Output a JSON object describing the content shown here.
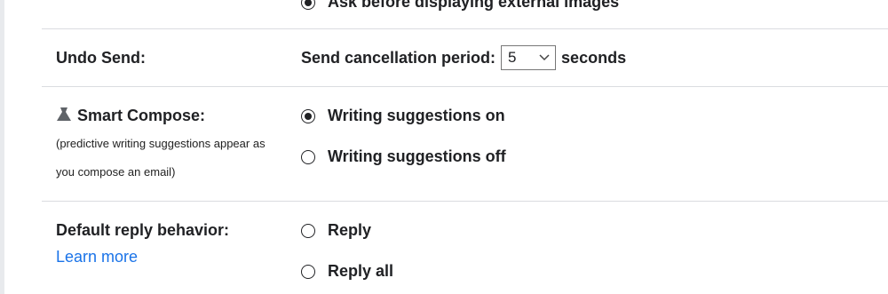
{
  "images": {
    "option_ask_external": "Ask before displaying external images"
  },
  "undo_send": {
    "label": "Undo Send:",
    "period_label": "Send cancellation period:",
    "value": "5",
    "unit": "seconds"
  },
  "smart_compose": {
    "label": "Smart Compose:",
    "icon": "flask-icon",
    "description_line1": "(predictive writing suggestions appear as",
    "description_line2": "you compose an email)",
    "options": [
      {
        "label": "Writing suggestions on",
        "selected": true
      },
      {
        "label": "Writing suggestions off",
        "selected": false
      }
    ]
  },
  "reply_behavior": {
    "label": "Default reply behavior:",
    "learn_more": "Learn more",
    "options": [
      {
        "label": "Reply",
        "selected": false
      },
      {
        "label": "Reply all",
        "selected": false
      }
    ]
  },
  "colors": {
    "text": "#202124",
    "link": "#1a73e8",
    "divider": "#dadce0"
  }
}
